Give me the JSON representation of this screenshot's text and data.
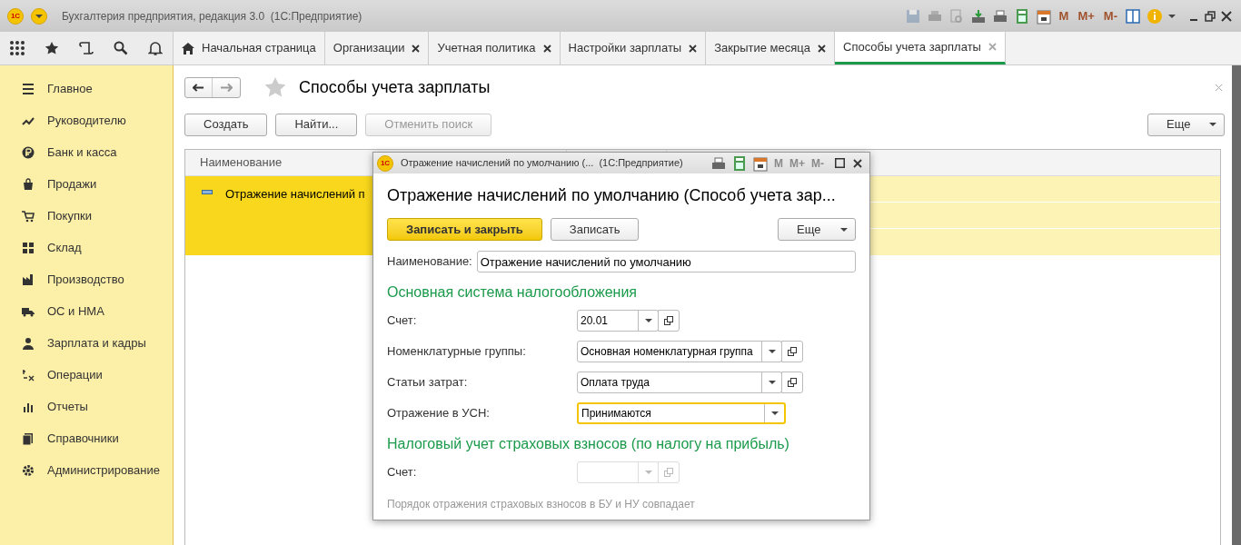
{
  "window": {
    "title": "Бухгалтерия предприятия, редакция 3.0  (1С:Предприятие)",
    "logo": "1С",
    "memory_buttons": [
      "M",
      "M+",
      "M-"
    ]
  },
  "tabs": [
    {
      "label": "Начальная страница",
      "kind": "home",
      "selected": false
    },
    {
      "label": "Организации",
      "kind": "doc",
      "selected": false
    },
    {
      "label": "Учетная политика",
      "kind": "doc",
      "selected": false
    },
    {
      "label": "Настройки зарплаты",
      "kind": "doc",
      "selected": false
    },
    {
      "label": "Закрытие месяца",
      "kind": "doc",
      "selected": false
    },
    {
      "label": "Способы учета зарплаты",
      "kind": "doc",
      "selected": true
    }
  ],
  "sidebar": {
    "items": [
      {
        "label": "Главное"
      },
      {
        "label": "Руководителю"
      },
      {
        "label": "Банк и касса"
      },
      {
        "label": "Продажи"
      },
      {
        "label": "Покупки"
      },
      {
        "label": "Склад"
      },
      {
        "label": "Производство"
      },
      {
        "label": "ОС и НМА"
      },
      {
        "label": "Зарплата и кадры"
      },
      {
        "label": "Операции"
      },
      {
        "label": "Отчеты"
      },
      {
        "label": "Справочники"
      },
      {
        "label": "Администрирование"
      }
    ]
  },
  "page": {
    "title": "Способы учета зарплаты",
    "buttons": [
      {
        "label": "Создать",
        "disabled": false
      },
      {
        "label": "Найти...",
        "disabled": false
      },
      {
        "label": "Отменить поиск",
        "disabled": true
      }
    ],
    "more_button": "Еще",
    "table": {
      "columns": [
        "Наименование"
      ],
      "rows": [
        {
          "name": "Отражение начислений п",
          "selected": true
        }
      ]
    }
  },
  "dialog": {
    "title": "Отражение начислений по умолчанию (...  (1С:Предприятие)",
    "logo": "1С",
    "memory_buttons": [
      "M",
      "M+",
      "M-"
    ],
    "heading": "Отражение начислений по умолчанию (Способ учета зар...",
    "buttons": [
      {
        "label": "Записать и закрыть",
        "primary": true
      },
      {
        "label": "Записать",
        "primary": false
      }
    ],
    "more_button": "Еще",
    "name_field": {
      "label": "Наименование:",
      "value": "Отражение начислений по умолчанию"
    },
    "sections": [
      {
        "title": "Основная система налогообложения",
        "fields": [
          {
            "label": "Счет:",
            "value": "20.01",
            "kind": "short",
            "disabled": false,
            "focused": false
          },
          {
            "label": "Номенклатурные группы:",
            "value": "Основная номенклатурная группа",
            "kind": "wide",
            "disabled": false,
            "focused": false
          },
          {
            "label": "Статьи затрат:",
            "value": "Оплата труда",
            "kind": "wide",
            "disabled": false,
            "focused": false
          },
          {
            "label": "Отражение в УСН:",
            "value": "Принимаются",
            "kind": "select",
            "disabled": false,
            "focused": true
          }
        ]
      },
      {
        "title": "Налоговый учет страховых взносов (по налогу на прибыль)",
        "fields": [
          {
            "label": "Счет:",
            "kind": "short",
            "disabled": true,
            "focused": false
          }
        ],
        "note": "Порядок отражения страховых взносов в БУ и НУ совпадает"
      }
    ]
  }
}
